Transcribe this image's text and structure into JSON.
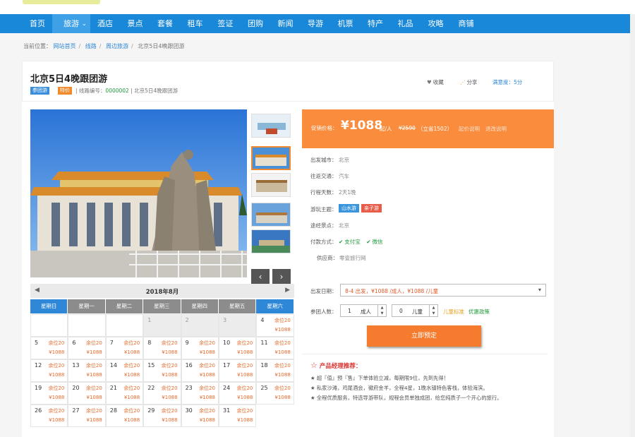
{
  "nav": {
    "items": [
      "首页",
      "旅游",
      "酒店",
      "景点",
      "套餐",
      "租车",
      "签证",
      "团购",
      "新闻",
      "导游",
      "机票",
      "特产",
      "礼品",
      "攻略",
      "商铺"
    ],
    "active_index": 1,
    "active_suffix": "⌄"
  },
  "breadcrumb": {
    "prefix": "当前位置：",
    "links": [
      "网站首页",
      "线路",
      "周边旅游"
    ],
    "current": "北京5日4晚跟团游"
  },
  "product": {
    "title": "北京5日4晚跟团游",
    "tag_group": "参团游",
    "tag_special": "特价",
    "route_no_label": "线路编号：",
    "route_no": "0000002",
    "route_name": "北京5日4晚跟团游",
    "favorite": "收藏",
    "share": "分享",
    "rating_label": "满意度：",
    "rating": "5分"
  },
  "price": {
    "label": "促销价格：",
    "amount": "¥1088",
    "unit": "起/人",
    "original": "¥2590",
    "saving": "（立省1502）",
    "link1": "起价说明",
    "link2": "退改说明"
  },
  "info": {
    "depart_city_label": "出发城市：",
    "depart_city": "北京",
    "transport_label": "往返交通：",
    "transport": "汽车",
    "days_label": "行程天数：",
    "days": "2天1晚",
    "theme_label": "游玩主题：",
    "themes": [
      "山水游",
      "亲子游"
    ],
    "via_label": "途经景点：",
    "via": "北京",
    "payment_label": "付款方式：",
    "payments": [
      "支付宝",
      "微信"
    ],
    "supplier_label": "供应商：",
    "supplier": "零壹旅行网"
  },
  "booking": {
    "date_label": "出发日期：",
    "date_value": "8-4 出发，¥1088 /成人，¥1088 /儿童",
    "people_label": "参团人数：",
    "adults": "1",
    "adult_unit": "成人",
    "children": "0",
    "child_unit": "儿童",
    "child_price_link": "儿童标准",
    "discount_link": "优惠政策",
    "book_button": "立即预定"
  },
  "recommend": {
    "title": "产品经理推荐：",
    "lines": [
      "★ 超『值』预『售』下单体验立减，每期限9位，先到先得！",
      "★ 私家沙滩，鸡尾酒会，徽府金羊，全程4星，1晚水镇特色客栈，体验海滨。",
      "★ 全程优质服务，特选导游带队，规程会员单独成团，给您纯质子一个开心的旅行。"
    ]
  },
  "calendar": {
    "month": "2018年8月",
    "prev": "◀",
    "next": "▶",
    "weekdays": [
      "星期日",
      "星期一",
      "星期二",
      "星期三",
      "星期四",
      "星期五",
      "星期六"
    ],
    "seat_text": "余位20",
    "price_text": "¥1088",
    "past_days": [
      "1",
      "2",
      "3"
    ],
    "days": [
      "4",
      "5",
      "6",
      "7",
      "8",
      "9",
      "10",
      "11",
      "12",
      "13",
      "14",
      "15",
      "16",
      "17",
      "18",
      "19",
      "20",
      "21",
      "22",
      "23",
      "24",
      "25",
      "26",
      "27",
      "28",
      "29",
      "30",
      "31"
    ]
  },
  "colors": {
    "nav_blue": "#1a88d8",
    "accent_orange": "#f98c3d",
    "price_red": "#e66a2c"
  }
}
